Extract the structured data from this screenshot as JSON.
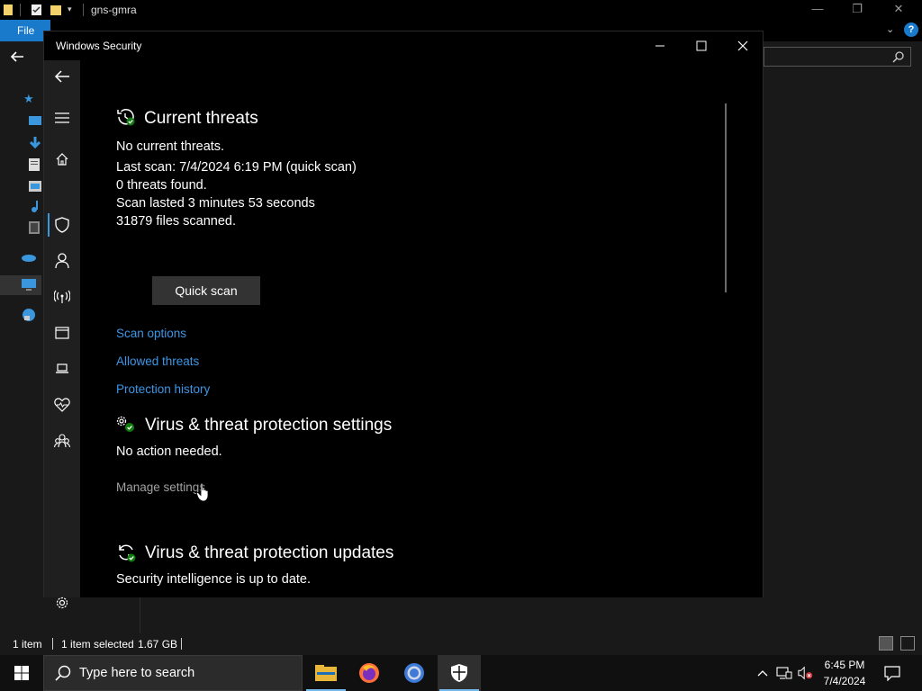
{
  "explorer": {
    "title": "gns-gmra",
    "file_tab": "File",
    "status": {
      "item_count": "1 item",
      "selected": "1 item selected",
      "size": "1.67 GB"
    }
  },
  "security": {
    "window_title": "Windows Security",
    "current_threats": {
      "title": "Current threats",
      "no_threats": "No current threats.",
      "last_scan": "Last scan: 7/4/2024 6:19 PM (quick scan)",
      "threats_found": "0 threats found.",
      "scan_duration": "Scan lasted 3 minutes 53 seconds",
      "files_scanned": "31879 files scanned.",
      "quick_scan_label": "Quick scan",
      "links": {
        "scan_options": "Scan options",
        "allowed_threats": "Allowed threats",
        "protection_history": "Protection history"
      }
    },
    "protection_settings": {
      "title": "Virus & threat protection settings",
      "status": "No action needed.",
      "manage_link": "Manage settings"
    },
    "protection_updates": {
      "title": "Virus & threat protection updates",
      "status": "Security intelligence is up to date."
    }
  },
  "taskbar": {
    "search_placeholder": "Type here to search",
    "time": "6:45 PM",
    "date": "7/4/2024"
  },
  "colors": {
    "accent": "#3c96e6",
    "nav_bg": "#1f1f1f",
    "button_bg": "#333333"
  }
}
